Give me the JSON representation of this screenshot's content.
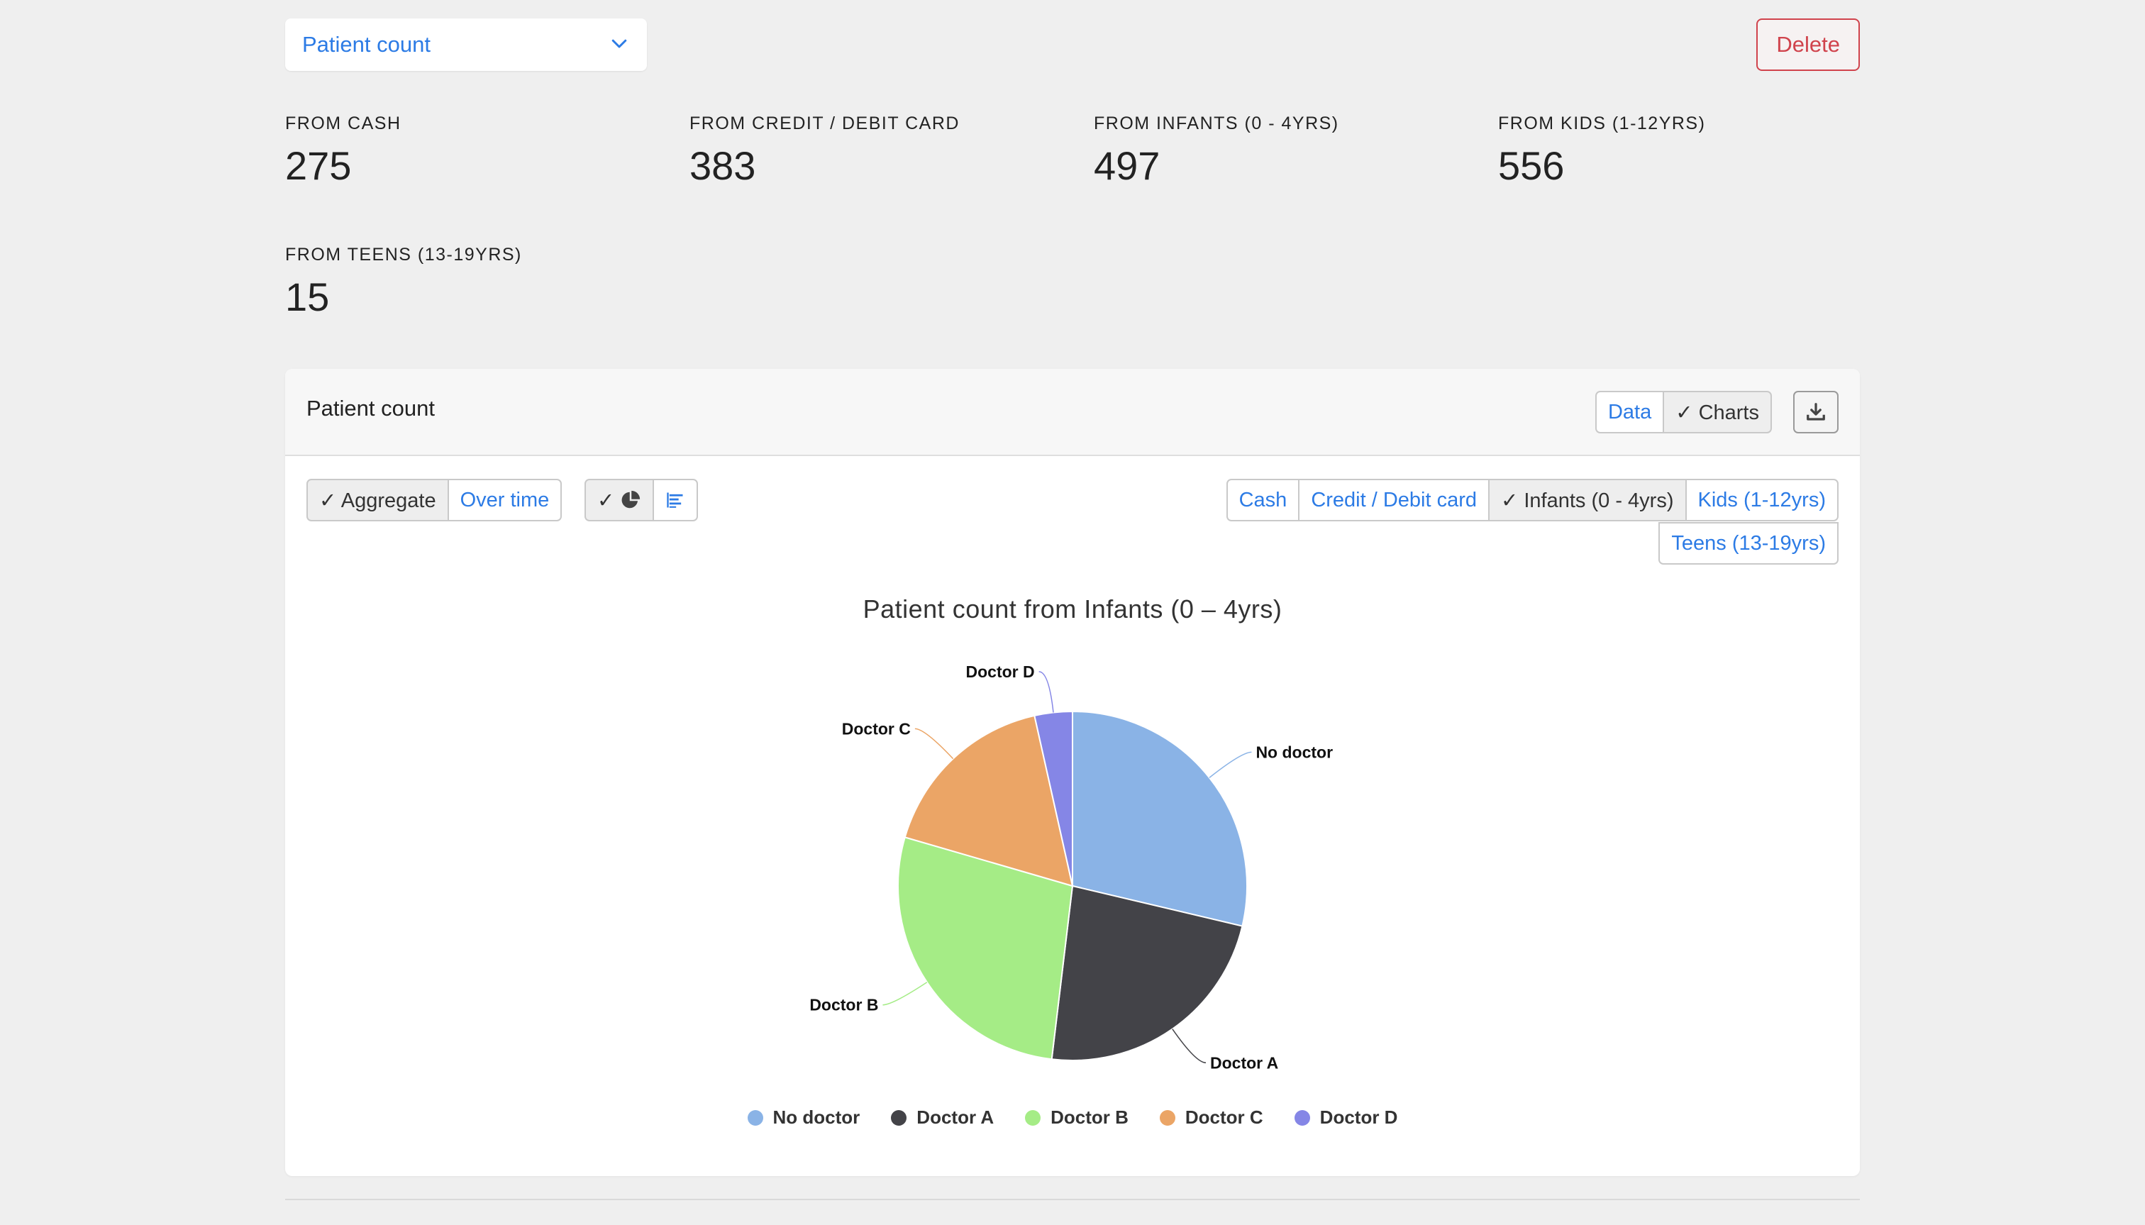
{
  "metric_select": {
    "label": "Patient count"
  },
  "delete_label": "Delete",
  "stats": [
    {
      "label": "FROM CASH",
      "value": "275"
    },
    {
      "label": "FROM CREDIT / DEBIT CARD",
      "value": "383"
    },
    {
      "label": "FROM INFANTS (0 - 4YRS)",
      "value": "497"
    },
    {
      "label": "FROM KIDS (1-12YRS)",
      "value": "556"
    },
    {
      "label": "FROM TEENS (13-19YRS)",
      "value": "15"
    }
  ],
  "panel": {
    "title": "Patient count",
    "view_toggle": {
      "data": "Data",
      "charts": "✓ Charts"
    },
    "mode_toggle": {
      "aggregate": "✓ Aggregate",
      "over_time": "Over time"
    },
    "chart_type_toggle": {
      "pie_check": "✓"
    },
    "segments": [
      {
        "label": "Cash",
        "active": false
      },
      {
        "label": "Credit / Debit card",
        "active": false
      },
      {
        "label": "✓ Infants (0 - 4yrs)",
        "active": true
      },
      {
        "label": "Kids (1-12yrs)",
        "active": false
      },
      {
        "label": "Teens (13-19yrs)",
        "active": false
      }
    ]
  },
  "colors": {
    "accent": "#2c7be5",
    "danger": "#d0434c"
  },
  "chart_data": {
    "type": "pie",
    "title": "Patient count from Infants (0 – 4yrs)",
    "categories": [
      "No doctor",
      "Doctor A",
      "Doctor B",
      "Doctor C",
      "Doctor D"
    ],
    "values": [
      28.7,
      23.2,
      27.6,
      17.0,
      3.5
    ],
    "colors": [
      "#8ab3e6",
      "#434348",
      "#a5ec86",
      "#eba566",
      "#8586e6"
    ],
    "legend_position": "bottom"
  }
}
